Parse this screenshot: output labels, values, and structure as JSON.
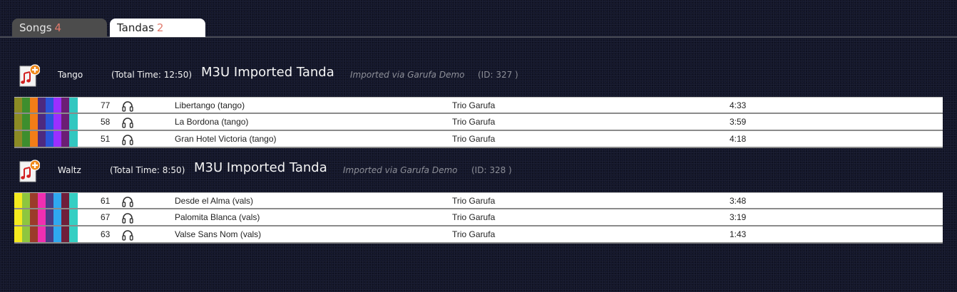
{
  "tabs": [
    {
      "label": "Songs",
      "count": "4"
    },
    {
      "label": "Tandas",
      "count": "2"
    }
  ],
  "tandas": [
    {
      "genre": "Tango",
      "total_time": "(Total Time: 12:50)",
      "name": "M3U Imported Tanda",
      "import_note": "Imported via Garufa Demo",
      "id_text": "(ID: 327 )",
      "icon": "music-note-add-icon",
      "stripe_colors": [
        "#8b8b25",
        "#3d8e2e",
        "#f27d17",
        "#4d2a80",
        "#2a55d9",
        "#9b2fff",
        "#6b1f74",
        "#32c7c0"
      ],
      "songs": [
        {
          "num": "77",
          "title": "Libertango (tango)",
          "artist": "Trio Garufa",
          "duration": "4:33",
          "listen_icon": "headphones-icon"
        },
        {
          "num": "58",
          "title": "La Bordona (tango)",
          "artist": "Trio Garufa",
          "duration": "3:59",
          "listen_icon": "headphones-icon"
        },
        {
          "num": "51",
          "title": "Gran Hotel Victoria (tango)",
          "artist": "Trio Garufa",
          "duration": "4:18",
          "listen_icon": "headphones-icon"
        }
      ]
    },
    {
      "genre": "Waltz",
      "total_time": "(Total Time: 8:50)",
      "name": "M3U Imported Tanda",
      "import_note": "Imported via Garufa Demo",
      "id_text": "(ID: 328 )",
      "icon": "music-note-add-icon",
      "stripe_colors": [
        "#f4ea1f",
        "#8ec63f",
        "#9b3b2a",
        "#ef2fb1",
        "#4a3c86",
        "#2fa8f0",
        "#6f1f3a",
        "#35cfc3"
      ],
      "songs": [
        {
          "num": "61",
          "title": "Desde el Alma (vals)",
          "artist": "Trio Garufa",
          "duration": "3:48",
          "listen_icon": "headphones-icon"
        },
        {
          "num": "67",
          "title": "Palomita Blanca (vals)",
          "artist": "Trio Garufa",
          "duration": "3:19",
          "listen_icon": "headphones-icon"
        },
        {
          "num": "63",
          "title": "Valse Sans Nom (vals)",
          "artist": "Trio Garufa",
          "duration": "1:43",
          "listen_icon": "headphones-icon"
        }
      ]
    }
  ]
}
